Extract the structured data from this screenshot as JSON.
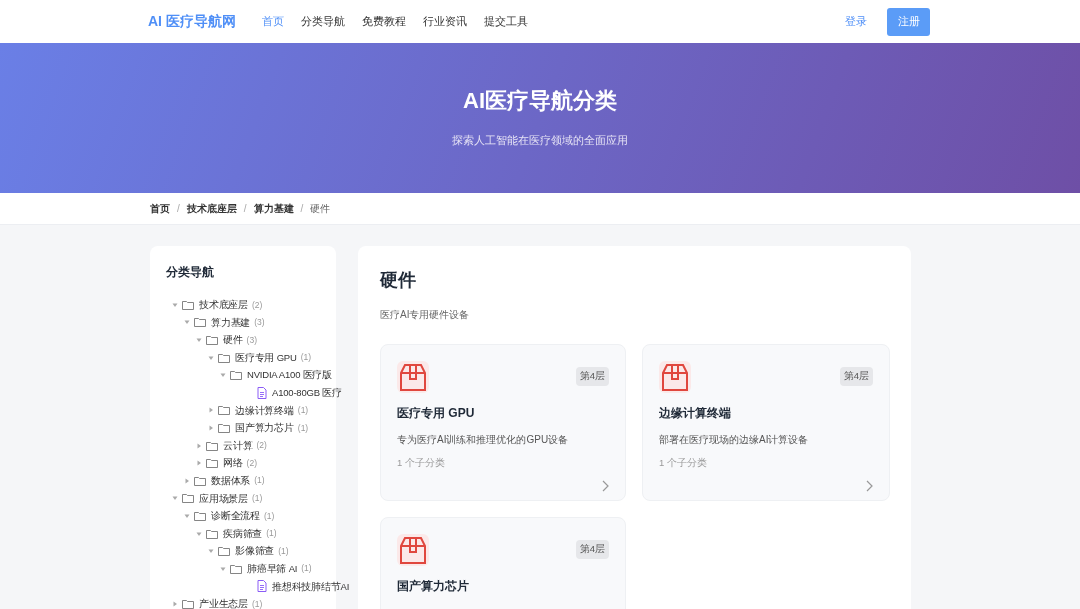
{
  "navbar": {
    "logo": "AI 医疗导航网",
    "links": [
      {
        "label": "首页",
        "selected": true
      },
      {
        "label": "分类导航",
        "selected": false
      },
      {
        "label": "免费教程",
        "selected": false
      },
      {
        "label": "行业资讯",
        "selected": false
      },
      {
        "label": "提交工具",
        "selected": false
      }
    ],
    "login": "登录",
    "register": "注册"
  },
  "hero": {
    "title": "AI医疗导航分类",
    "subtitle": "探索人工智能在医疗领域的全面应用"
  },
  "breadcrumb": [
    {
      "label": "首页",
      "current": false
    },
    {
      "separator": "/",
      "label": "技术底座层",
      "current": false
    },
    {
      "separator": "/",
      "label": "算力基建",
      "current": false
    },
    {
      "separator": "/",
      "label": "硬件",
      "current": true
    }
  ],
  "sidebar": {
    "title": "分类导航",
    "tree": [
      {
        "kind": "folder",
        "label": "技术底座层",
        "count": "(2)",
        "expanded": true,
        "children": [
          {
            "kind": "folder",
            "label": "算力基建",
            "count": "(3)",
            "expanded": true,
            "children": [
              {
                "kind": "folder",
                "label": "硬件",
                "count": "(3)",
                "expanded": true,
                "children": [
                  {
                    "kind": "folder",
                    "label": "医疗专用 GPU",
                    "count": "(1)",
                    "expanded": true,
                    "children": [
                      {
                        "kind": "folder",
                        "label": "NVIDIA A100 医疗版",
                        "expanded": true,
                        "children": [
                          {
                            "kind": "file",
                            "label": "A100-80GB 医疗"
                          }
                        ]
                      }
                    ]
                  },
                  {
                    "kind": "folder",
                    "label": "边缘计算终端",
                    "count": "(1)",
                    "expanded": false
                  },
                  {
                    "kind": "folder",
                    "label": "国产算力芯片",
                    "count": "(1)",
                    "expanded": false
                  }
                ]
              },
              {
                "kind": "folder",
                "label": "云计算",
                "count": "(2)",
                "expanded": false
              },
              {
                "kind": "folder",
                "label": "网络",
                "count": "(2)",
                "expanded": false
              }
            ]
          },
          {
            "kind": "folder",
            "label": "数据体系",
            "count": "(1)",
            "expanded": false
          }
        ]
      },
      {
        "kind": "folder",
        "label": "应用场景层",
        "count": "(1)",
        "expanded": true,
        "children": [
          {
            "kind": "folder",
            "label": "诊断全流程",
            "count": "(1)",
            "expanded": true,
            "children": [
              {
                "kind": "folder",
                "label": "疾病筛查",
                "count": "(1)",
                "expanded": true,
                "children": [
                  {
                    "kind": "folder",
                    "label": "影像筛查",
                    "count": "(1)",
                    "expanded": true,
                    "children": [
                      {
                        "kind": "folder",
                        "label": "肺癌早筛 AI",
                        "count": "(1)",
                        "expanded": true,
                        "children": [
                          {
                            "kind": "file",
                            "label": "推想科技肺结节AI"
                          }
                        ]
                      }
                    ]
                  }
                ]
              }
            ]
          }
        ]
      },
      {
        "kind": "folder",
        "label": "产业生态层",
        "count": "(1)",
        "expanded": false
      }
    ]
  },
  "content": {
    "title": "硬件",
    "description": "医疗AI专用硬件设备",
    "cards": [
      {
        "title": "医疗专用 GPU",
        "badge": "第4层",
        "description": "专为医疗AI训练和推理优化的GPU设备",
        "meta": "1 个子分类"
      },
      {
        "title": "边缘计算终端",
        "badge": "第4层",
        "description": "部署在医疗现场的边缘AI计算设备",
        "meta": "1 个子分类"
      },
      {
        "title": "国产算力芯片",
        "badge": "第4层"
      }
    ]
  }
}
